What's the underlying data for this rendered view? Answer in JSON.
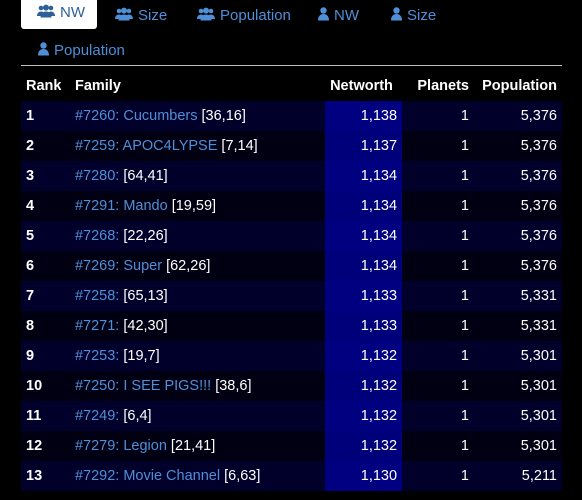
{
  "tabs": [
    {
      "label": "NW",
      "icon": "users-icon",
      "active": true
    },
    {
      "label": "Size",
      "icon": "users-icon",
      "active": false
    },
    {
      "label": "Population",
      "icon": "users-icon",
      "active": false
    },
    {
      "label": "NW",
      "icon": "user-icon",
      "active": false
    },
    {
      "label": "Size",
      "icon": "user-icon",
      "active": false
    },
    {
      "label": "Population",
      "icon": "user-icon",
      "active": false
    }
  ],
  "table": {
    "headers": [
      "Rank",
      "Family",
      "Networth",
      "Planets",
      "Population"
    ],
    "rows": [
      {
        "rank": "1",
        "link": "#7260: Cucumbers",
        "coords": " [36,16]",
        "networth": "1,138",
        "planets": "1",
        "population": "5,376"
      },
      {
        "rank": "2",
        "link": "#7259: APOC4LYPSE",
        "coords": " [7,14]",
        "networth": "1,137",
        "planets": "1",
        "population": "5,376"
      },
      {
        "rank": "3",
        "link": "#7280:",
        "coords": " [64,41]",
        "networth": "1,134",
        "planets": "1",
        "population": "5,376"
      },
      {
        "rank": "4",
        "link": "#7291: Mando",
        "coords": " [19,59]",
        "networth": "1,134",
        "planets": "1",
        "population": "5,376"
      },
      {
        "rank": "5",
        "link": "#7268:",
        "coords": " [22,26]",
        "networth": "1,134",
        "planets": "1",
        "population": "5,376"
      },
      {
        "rank": "6",
        "link": "#7269: Super",
        "coords": " [62,26]",
        "networth": "1,134",
        "planets": "1",
        "population": "5,376"
      },
      {
        "rank": "7",
        "link": "#7258:",
        "coords": " [65,13]",
        "networth": "1,133",
        "planets": "1",
        "population": "5,331"
      },
      {
        "rank": "8",
        "link": "#7271:",
        "coords": " [42,30]",
        "networth": "1,133",
        "planets": "1",
        "population": "5,331"
      },
      {
        "rank": "9",
        "link": "#7253:",
        "coords": " [19,7]",
        "networth": "1,132",
        "planets": "1",
        "population": "5,301"
      },
      {
        "rank": "10",
        "link": "#7250: I SEE PIGS!!!",
        "coords": " [38,6]",
        "networth": "1,132",
        "planets": "1",
        "population": "5,301"
      },
      {
        "rank": "11",
        "link": "#7249:",
        "coords": " [6,4]",
        "networth": "1,132",
        "planets": "1",
        "population": "5,301"
      },
      {
        "rank": "12",
        "link": "#7279: Legion",
        "coords": " [21,41]",
        "networth": "1,132",
        "planets": "1",
        "population": "5,301"
      },
      {
        "rank": "13",
        "link": "#7292: Movie Channel",
        "coords": " [6,63]",
        "networth": "1,130",
        "planets": "1",
        "population": "5,211"
      }
    ]
  },
  "colors": {
    "background": "#000000",
    "link": "#4f8fd8",
    "networth_column": "#000080",
    "row_odd": "#00002a",
    "row_even": "#000012"
  }
}
